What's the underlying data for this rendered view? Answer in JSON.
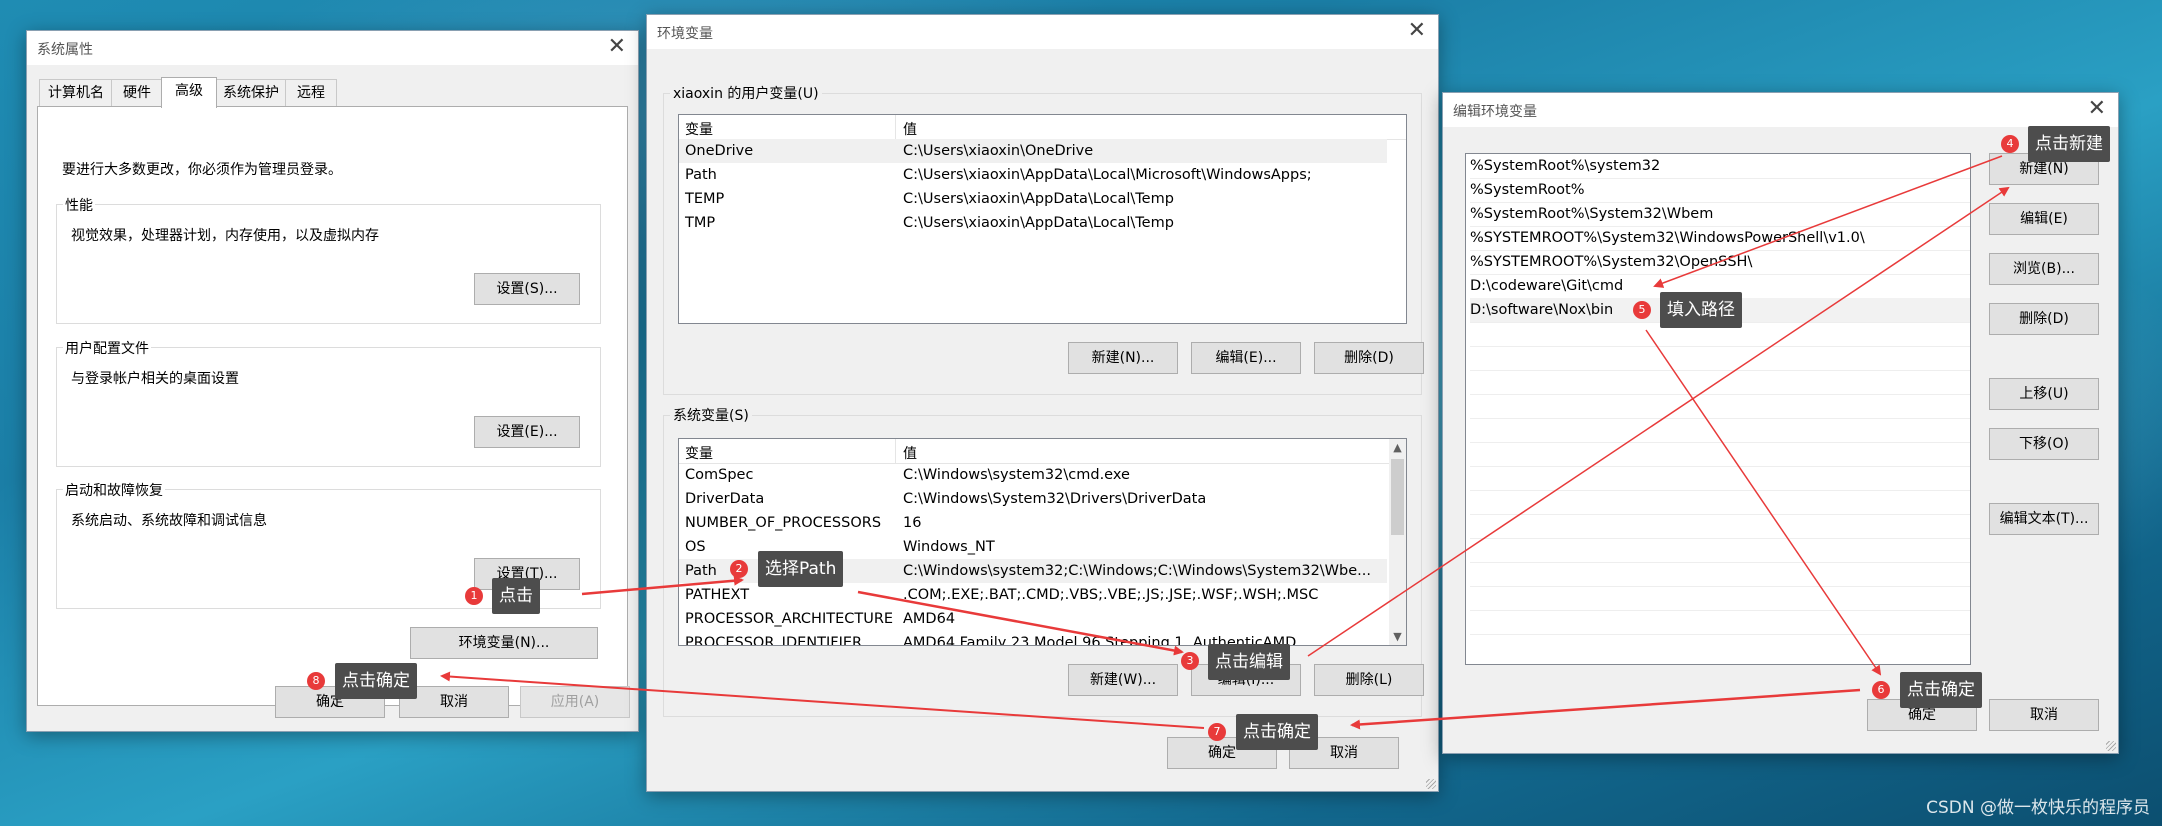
{
  "sysprops": {
    "title": "系统属性",
    "tabs": [
      "计算机名",
      "硬件",
      "高级",
      "系统保护",
      "远程"
    ],
    "admin_note": "要进行大多数更改，你必须作为管理员登录。",
    "perf": {
      "label": "性能",
      "desc": "视觉效果，处理器计划，内存使用，以及虚拟内存",
      "button": "设置(S)..."
    },
    "profile": {
      "label": "用户配置文件",
      "desc": "与登录帐户相关的桌面设置",
      "button": "设置(E)..."
    },
    "startup": {
      "label": "启动和故障恢复",
      "desc": "系统启动、系统故障和调试信息",
      "button": "设置(T)..."
    },
    "envvars_button": "环境变量(N)...",
    "ok": "确定",
    "cancel": "取消",
    "apply": "应用(A)"
  },
  "envvars": {
    "title": "环境变量",
    "user_group": "xiaoxin 的用户变量(U)",
    "headers": [
      "变量",
      "值"
    ],
    "user_vars": [
      {
        "name": "OneDrive",
        "value": "C:\\Users\\xiaoxin\\OneDrive"
      },
      {
        "name": "Path",
        "value": "C:\\Users\\xiaoxin\\AppData\\Local\\Microsoft\\WindowsApps;"
      },
      {
        "name": "TEMP",
        "value": "C:\\Users\\xiaoxin\\AppData\\Local\\Temp"
      },
      {
        "name": "TMP",
        "value": "C:\\Users\\xiaoxin\\AppData\\Local\\Temp"
      }
    ],
    "user_buttons": {
      "new": "新建(N)...",
      "edit": "编辑(E)...",
      "delete": "删除(D)"
    },
    "sys_group": "系统变量(S)",
    "sys_vars": [
      {
        "name": "ComSpec",
        "value": "C:\\Windows\\system32\\cmd.exe"
      },
      {
        "name": "DriverData",
        "value": "C:\\Windows\\System32\\Drivers\\DriverData"
      },
      {
        "name": "NUMBER_OF_PROCESSORS",
        "value": "16"
      },
      {
        "name": "OS",
        "value": "Windows_NT"
      },
      {
        "name": "Path",
        "value": "C:\\Windows\\system32;C:\\Windows;C:\\Windows\\System32\\Wbe..."
      },
      {
        "name": "PATHEXT",
        "value": ".COM;.EXE;.BAT;.CMD;.VBS;.VBE;.JS;.JSE;.WSF;.WSH;.MSC"
      },
      {
        "name": "PROCESSOR_ARCHITECTURE",
        "value": "AMD64"
      },
      {
        "name": "PROCESSOR_IDENTIFIER",
        "value": "AMD64 Family 23 Model 96 Stepping 1, AuthenticAMD"
      }
    ],
    "sys_buttons": {
      "new": "新建(W)...",
      "edit": "编辑(I)...",
      "delete": "删除(L)"
    },
    "ok": "确定",
    "cancel": "取消"
  },
  "editenv": {
    "title": "编辑环境变量",
    "entries": [
      "%SystemRoot%\\system32",
      "%SystemRoot%",
      "%SystemRoot%\\System32\\Wbem",
      "%SYSTEMROOT%\\System32\\WindowsPowerShell\\v1.0\\",
      "%SYSTEMROOT%\\System32\\OpenSSH\\",
      "D:\\codeware\\Git\\cmd",
      "D:\\software\\Nox\\bin"
    ],
    "buttons": {
      "new": "新建(N)",
      "edit": "编辑(E)",
      "browse": "浏览(B)...",
      "delete": "删除(D)",
      "up": "上移(U)",
      "down": "下移(O)",
      "edit_text": "编辑文本(T)..."
    },
    "ok": "确定",
    "cancel": "取消"
  },
  "annotations": {
    "color": "#e83a3a",
    "steps": [
      {
        "num": "1",
        "text": "点击"
      },
      {
        "num": "2",
        "text": "选择Path"
      },
      {
        "num": "3",
        "text": "点击编辑"
      },
      {
        "num": "4",
        "text": "点击新建"
      },
      {
        "num": "5",
        "text": "填入路径"
      },
      {
        "num": "6",
        "text": "点击确定"
      },
      {
        "num": "7",
        "text": "点击确定"
      },
      {
        "num": "8",
        "text": "点击确定"
      }
    ]
  },
  "watermark": "CSDN @做一枚快乐的程序员"
}
